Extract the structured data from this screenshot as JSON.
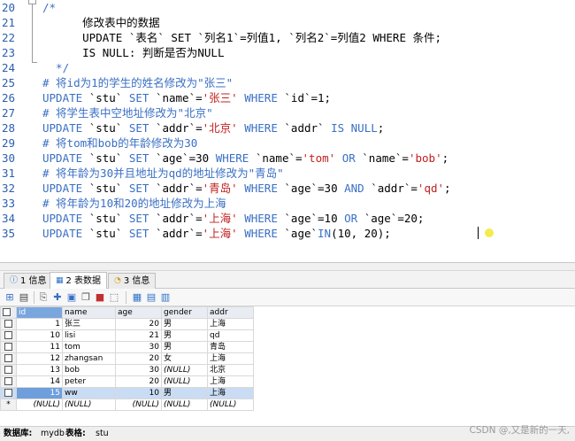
{
  "editor": {
    "lines": [
      {
        "n": "20",
        "seg": [
          [
            "cm",
            "/*"
          ]
        ]
      },
      {
        "n": "21",
        "seg": [
          [
            "txt",
            "      修改表中的数据"
          ]
        ]
      },
      {
        "n": "22",
        "seg": [
          [
            "txt",
            "      UPDATE `表名` SET `列名1`=列值1, `列名2`=列值2 WHERE 条件;"
          ]
        ]
      },
      {
        "n": "23",
        "seg": [
          [
            "txt",
            "      IS NULL: 判断是否为NULL"
          ]
        ]
      },
      {
        "n": "24",
        "seg": [
          [
            "cm",
            "  */"
          ]
        ]
      },
      {
        "n": "25",
        "seg": [
          [
            "cm",
            "# 将id为1的学生的姓名修改为\"张三\""
          ]
        ]
      },
      {
        "n": "26",
        "seg": [
          [
            "kw",
            "UPDATE "
          ],
          [
            "txt",
            "`stu` "
          ],
          [
            "kw",
            "SET "
          ],
          [
            "txt",
            "`name`="
          ],
          [
            "str",
            "'张三'"
          ],
          [
            "kw",
            " WHERE "
          ],
          [
            "txt",
            "`id`=1;"
          ]
        ]
      },
      {
        "n": "27",
        "seg": [
          [
            "cm",
            "# 将学生表中空地址修改为\"北京\""
          ]
        ]
      },
      {
        "n": "28",
        "seg": [
          [
            "kw",
            "UPDATE "
          ],
          [
            "txt",
            "`stu` "
          ],
          [
            "kw",
            "SET "
          ],
          [
            "txt",
            "`addr`="
          ],
          [
            "str",
            "'北京'"
          ],
          [
            "kw",
            " WHERE "
          ],
          [
            "txt",
            "`addr` "
          ],
          [
            "kw",
            "IS NULL"
          ],
          [
            "txt",
            ";"
          ]
        ]
      },
      {
        "n": "29",
        "seg": [
          [
            "cm",
            "# 将tom和bob的年龄修改为30"
          ]
        ]
      },
      {
        "n": "30",
        "seg": [
          [
            "kw",
            "UPDATE "
          ],
          [
            "txt",
            "`stu` "
          ],
          [
            "kw",
            "SET "
          ],
          [
            "txt",
            "`age`=30 "
          ],
          [
            "kw",
            "WHERE "
          ],
          [
            "txt",
            "`name`="
          ],
          [
            "str",
            "'tom'"
          ],
          [
            "kw",
            " OR "
          ],
          [
            "txt",
            "`name`="
          ],
          [
            "str",
            "'bob'"
          ],
          [
            "txt",
            ";"
          ]
        ]
      },
      {
        "n": "31",
        "seg": [
          [
            "cm",
            "# 将年龄为30并且地址为qd的地址修改为\"青岛\""
          ]
        ]
      },
      {
        "n": "32",
        "seg": [
          [
            "kw",
            "UPDATE "
          ],
          [
            "txt",
            "`stu` "
          ],
          [
            "kw",
            "SET "
          ],
          [
            "txt",
            "`addr`="
          ],
          [
            "str",
            "'青岛'"
          ],
          [
            "kw",
            " WHERE "
          ],
          [
            "txt",
            "`age`=30 "
          ],
          [
            "kw",
            "AND "
          ],
          [
            "txt",
            "`addr`="
          ],
          [
            "str",
            "'qd'"
          ],
          [
            "txt",
            ";"
          ]
        ]
      },
      {
        "n": "33",
        "seg": [
          [
            "cm",
            "# 将年龄为10和20的地址修改为上海"
          ]
        ]
      },
      {
        "n": "34",
        "seg": [
          [
            "kw",
            "UPDATE "
          ],
          [
            "txt",
            "`stu` "
          ],
          [
            "kw",
            "SET "
          ],
          [
            "txt",
            "`addr`="
          ],
          [
            "str",
            "'上海'"
          ],
          [
            "kw",
            " WHERE "
          ],
          [
            "txt",
            "`age`=10 "
          ],
          [
            "kw",
            "OR "
          ],
          [
            "txt",
            "`age`=20;"
          ]
        ]
      },
      {
        "n": "35",
        "seg": [
          [
            "kw",
            "UPDATE "
          ],
          [
            "txt",
            "`stu` "
          ],
          [
            "kw",
            "SET "
          ],
          [
            "txt",
            "`addr`="
          ],
          [
            "str",
            "'上海'"
          ],
          [
            "kw",
            " WHERE "
          ],
          [
            "txt",
            "`age`"
          ],
          [
            "kw",
            "IN"
          ],
          [
            "txt",
            "(10, 20);"
          ]
        ]
      }
    ]
  },
  "tabs": [
    {
      "icon": "ⓘ",
      "label": "1 信息"
    },
    {
      "icon": "▦",
      "label": "2 表数据"
    },
    {
      "icon": "◔",
      "label": "3 信息"
    }
  ],
  "grid": {
    "columns": [
      "id",
      "name",
      "age",
      "gender",
      "addr"
    ],
    "rows": [
      [
        "1",
        "张三",
        "20",
        "男",
        "上海"
      ],
      [
        "10",
        "lisi",
        "21",
        "男",
        "qd"
      ],
      [
        "11",
        "tom",
        "30",
        "男",
        "青岛"
      ],
      [
        "12",
        "zhangsan",
        "20",
        "女",
        "上海"
      ],
      [
        "13",
        "bob",
        "30",
        "(NULL)",
        "北京"
      ],
      [
        "14",
        "peter",
        "20",
        "(NULL)",
        "上海"
      ],
      [
        "15",
        "ww",
        "10",
        "男",
        "上海"
      ],
      [
        "(NULL)",
        "(NULL)",
        "(NULL)",
        "(NULL)",
        "(NULL)"
      ]
    ],
    "new_row_marker": "*"
  },
  "status": {
    "db_label": "数据库:",
    "db_value": "mydb",
    "table_label": "表格:",
    "table_value": "stu"
  },
  "watermark": "CSDN @,又是新的一天,",
  "colors": {
    "keyword": "#3a6fc4",
    "string": "#c0201f",
    "selected_row": "#c9dcf4",
    "selected_header": "#7aa6de"
  }
}
